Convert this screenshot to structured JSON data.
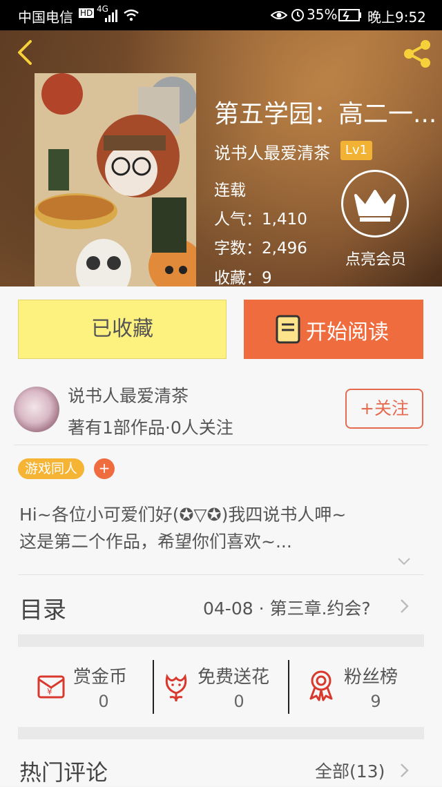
{
  "status": {
    "carrier": "中国电信",
    "network": "4G",
    "battery": "35%",
    "time": "晚上9:52"
  },
  "book": {
    "title": "第五学园：高二一...",
    "author": "说书人最爱清茶",
    "level": "Lv1",
    "status": "连载",
    "popularity": "人气：1,410",
    "word_count": "字数：2,496",
    "favorites": "收藏：9",
    "vip_label": "点亮会员"
  },
  "actions": {
    "collect_label": "已收藏",
    "read_label": "开始阅读"
  },
  "author_card": {
    "name": "说书人最爱清茶",
    "meta": "著有1部作品·0人关注",
    "follow_label": "+关注"
  },
  "tags": {
    "tag1": "游戏同人",
    "add": "+"
  },
  "description": {
    "line1": "Hi~各位小可爱们好(✪▽✪)我四说书人呷~",
    "line2": "这是第二个作品，希望你们喜欢~..."
  },
  "toc": {
    "label": "目录",
    "latest": "04-08 · 第三章.约会?"
  },
  "support": {
    "coins_label": "赏金币",
    "coins_value": "0",
    "flower_label": "免费送花",
    "flower_value": "0",
    "fans_label": "粉丝榜",
    "fans_value": "9"
  },
  "comments": {
    "label": "热门评论",
    "all": "全部(13)"
  },
  "colors": {
    "accent_orange": "#ee6c3e",
    "collect_yellow": "#fdf17f",
    "tag_yellow": "#f6b435",
    "follow_red": "#e56a50"
  }
}
